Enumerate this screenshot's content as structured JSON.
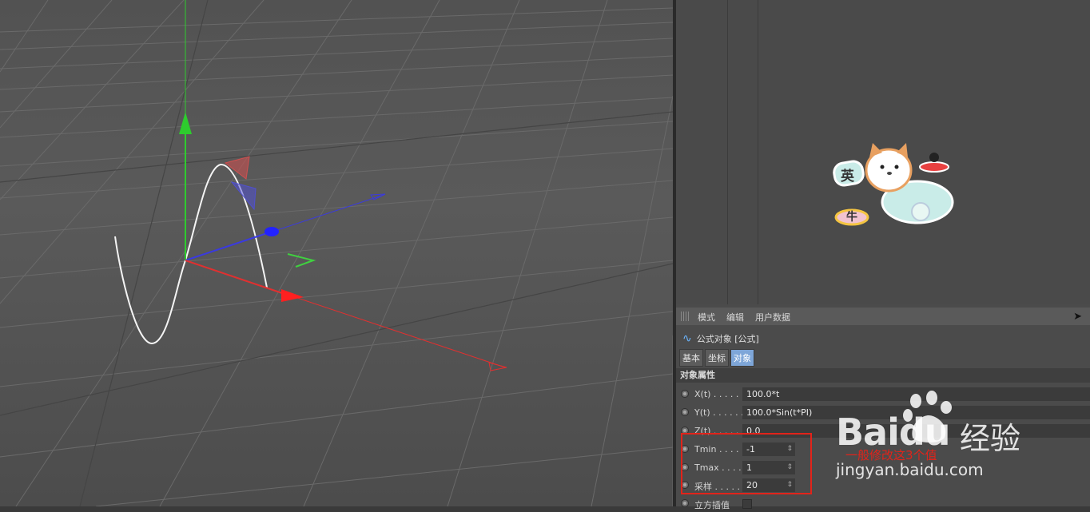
{
  "menu": {
    "mode": "模式",
    "edit": "编辑",
    "userdata": "用户数据"
  },
  "object": {
    "title": "公式对象 [公式]",
    "icon": "formula-spline-icon"
  },
  "tabs": [
    {
      "label": "基本"
    },
    {
      "label": "坐标"
    },
    {
      "label": "对象"
    }
  ],
  "section": "对象属性",
  "fields": {
    "xt": {
      "label": "X(t) . . . . . .",
      "value": "100.0*t"
    },
    "yt": {
      "label": "Y(t) . . . . . .",
      "value": "100.0*Sin(t*PI)"
    },
    "zt": {
      "label": "Z(t) . . . . . .",
      "value": "0.0"
    },
    "tmin": {
      "label": "Tmin . . . . .",
      "value": "-1"
    },
    "tmax": {
      "label": "Tmax . . . .",
      "value": "1"
    },
    "samples": {
      "label": "采样 . . . . .",
      "value": "20"
    },
    "cubic": {
      "label": "立方插值"
    }
  },
  "annotation": "一般修改这3个值",
  "sticker": {
    "badge1": "英",
    "badge2": "⽜"
  },
  "watermark": {
    "brand": "Baidu",
    "brand_cn": "经验",
    "site": "jingyan.baidu.com"
  },
  "colors": {
    "accent_tab": "#7ea6d8",
    "annotation_red": "#e2231a",
    "axis_x": "#e03030",
    "axis_y": "#2ecc2e",
    "axis_z": "#3a3ae0"
  }
}
